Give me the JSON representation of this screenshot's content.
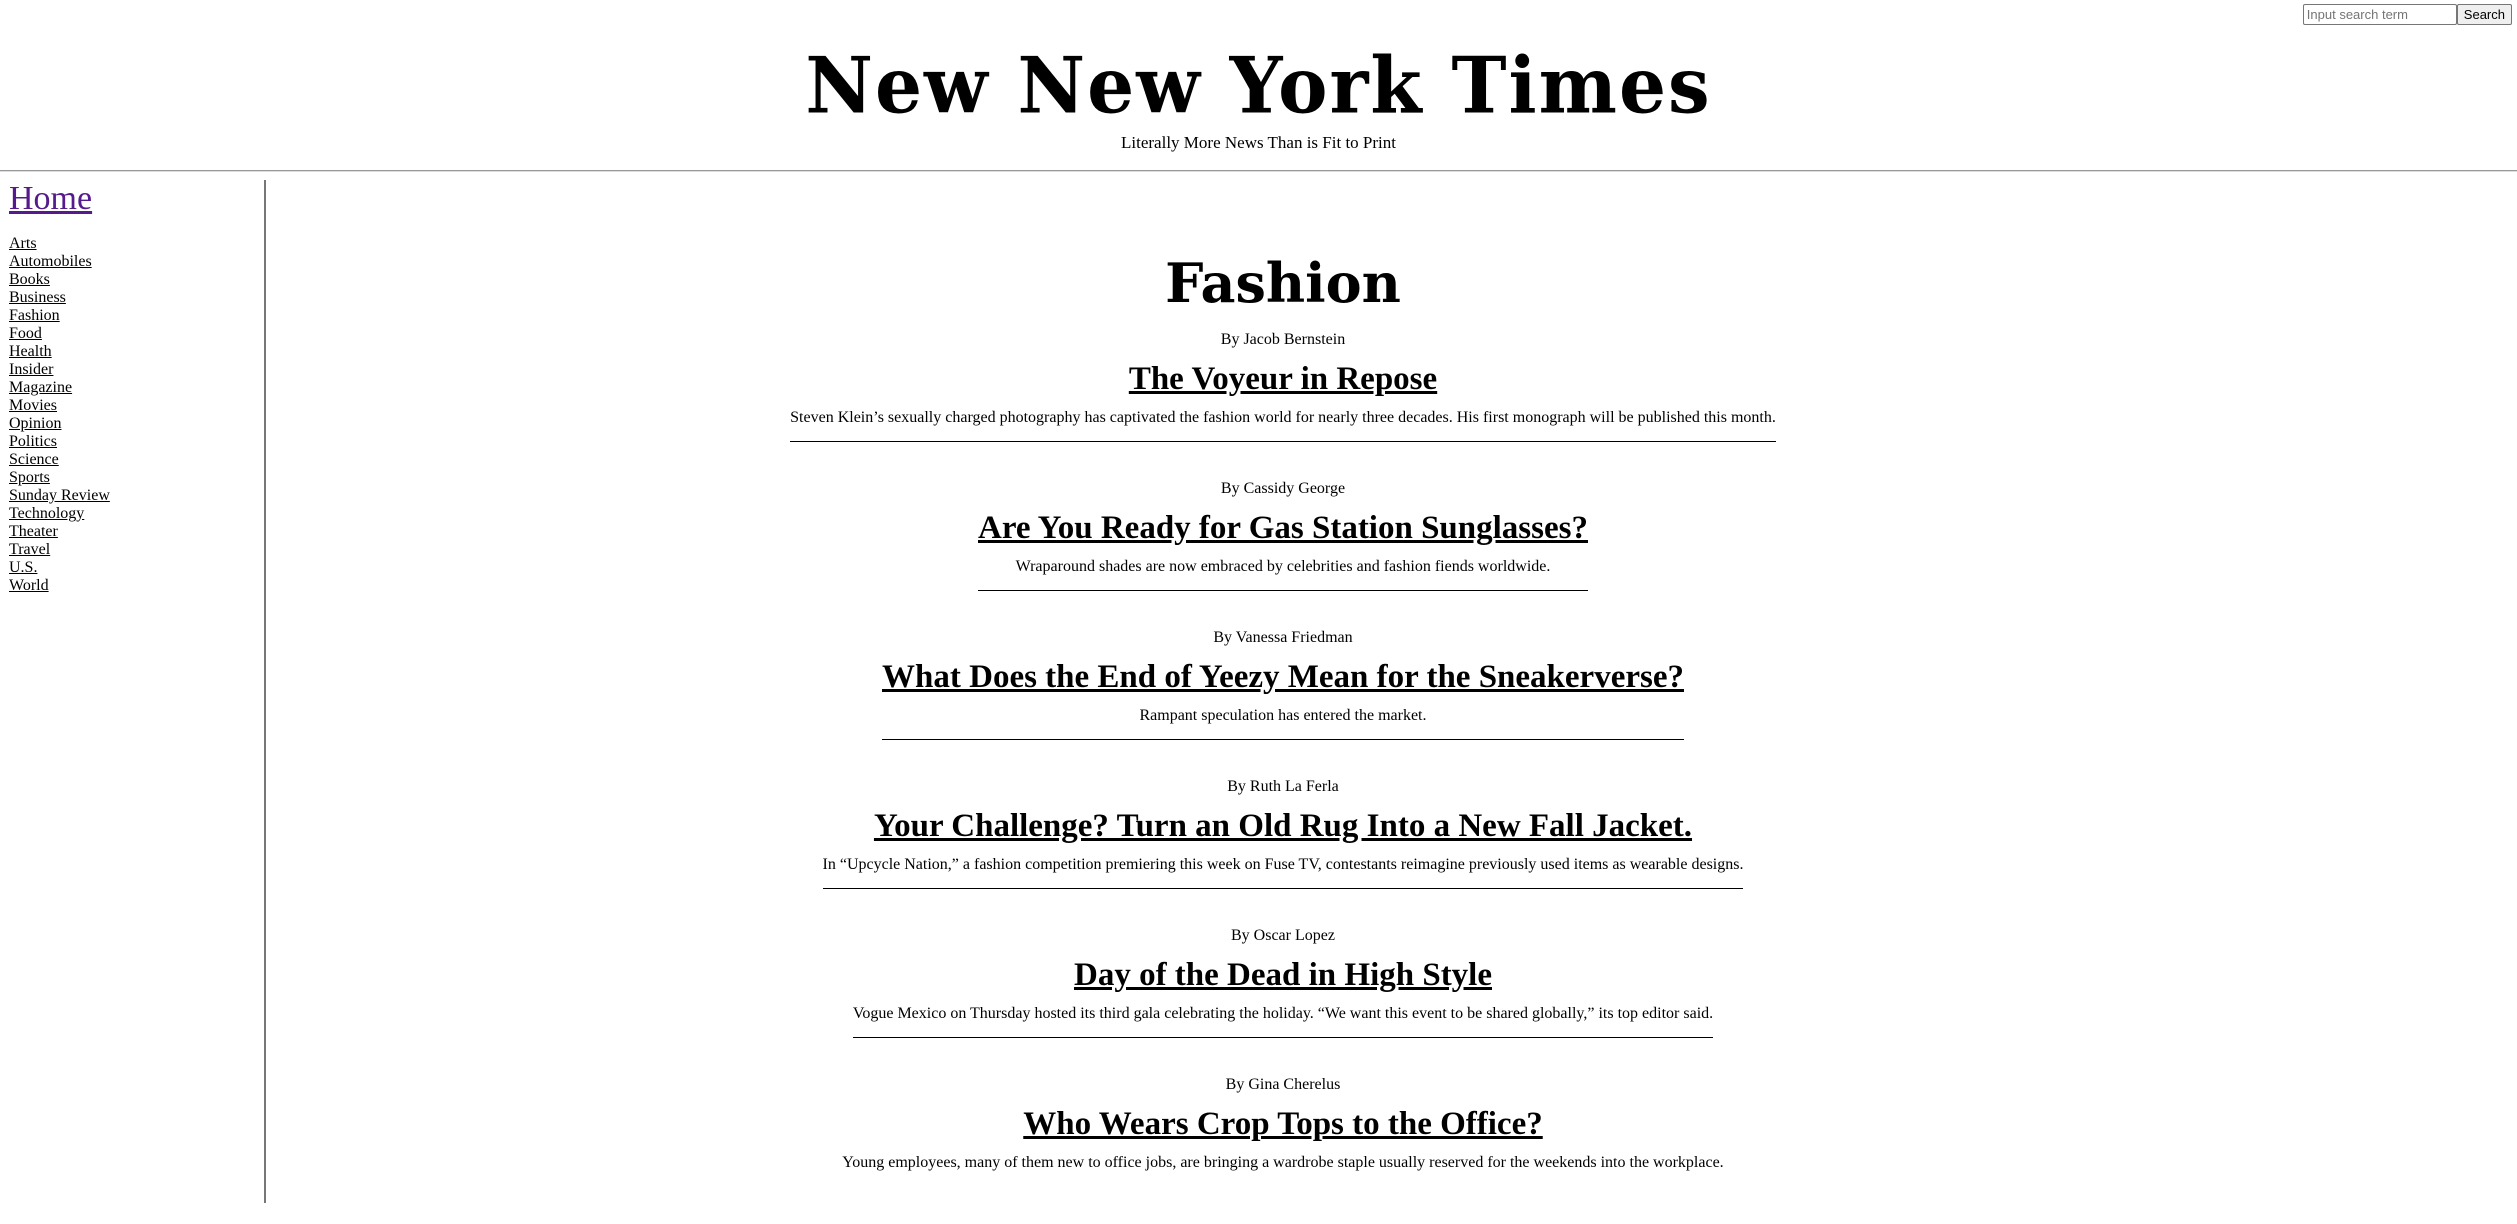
{
  "search": {
    "placeholder": "Input search term",
    "button_label": "Search"
  },
  "masthead": {
    "title": "New New York Times",
    "tagline": "Literally More News Than is Fit to Print"
  },
  "sidebar": {
    "home_label": "Home",
    "items": [
      {
        "label": "Arts"
      },
      {
        "label": "Automobiles"
      },
      {
        "label": "Books"
      },
      {
        "label": "Business"
      },
      {
        "label": "Fashion"
      },
      {
        "label": "Food"
      },
      {
        "label": "Health"
      },
      {
        "label": "Insider"
      },
      {
        "label": "Magazine"
      },
      {
        "label": "Movies"
      },
      {
        "label": "Opinion"
      },
      {
        "label": "Politics"
      },
      {
        "label": "Science"
      },
      {
        "label": "Sports"
      },
      {
        "label": "Sunday Review"
      },
      {
        "label": "Technology"
      },
      {
        "label": "Theater"
      },
      {
        "label": "Travel"
      },
      {
        "label": "U.S."
      },
      {
        "label": "World"
      }
    ]
  },
  "main": {
    "section_title": "Fashion",
    "articles": [
      {
        "byline": "By Jacob Bernstein",
        "headline": "The Voyeur in Repose",
        "summary": "Steven Klein’s sexually charged photography has captivated the fashion world for nearly three decades. His first monograph will be published this month."
      },
      {
        "byline": "By Cassidy George",
        "headline": "Are You Ready for Gas Station Sunglasses?",
        "summary": "Wraparound shades are now embraced by celebrities and fashion fiends worldwide."
      },
      {
        "byline": "By Vanessa Friedman",
        "headline": "What Does the End of Yeezy Mean for the Sneakerverse?",
        "summary": "Rampant speculation has entered the market."
      },
      {
        "byline": "By Ruth La Ferla",
        "headline": "Your Challenge? Turn an Old Rug Into a New Fall Jacket.",
        "summary": "In “Upcycle Nation,” a fashion competition premiering this week on Fuse TV, contestants reimagine previously used items as wearable designs."
      },
      {
        "byline": "By Oscar Lopez",
        "headline": "Day of the Dead in High Style",
        "summary": "Vogue Mexico on Thursday hosted its third gala celebrating the holiday. “We want this event to be shared globally,” its top editor said."
      },
      {
        "byline": "By Gina Cherelus",
        "headline": "Who Wears Crop Tops to the Office?",
        "summary": "Young employees, many of them new to office jobs, are bringing a wardrobe staple usually reserved for the weekends into the workplace."
      }
    ]
  }
}
